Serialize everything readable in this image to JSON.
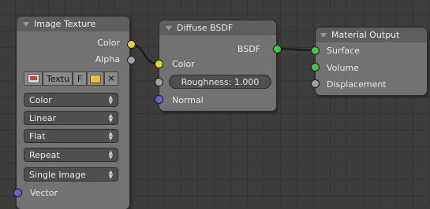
{
  "nodes": {
    "image_texture": {
      "title": "Image Texture",
      "outputs": [
        "Color",
        "Alpha"
      ],
      "image_field": {
        "name": "Textu",
        "fake_user": "F"
      },
      "color_space": "Color",
      "interpolation": "Linear",
      "projection": "Flat",
      "extension": "Repeat",
      "source": "Single Image",
      "input": "Vector"
    },
    "diffuse_bsdf": {
      "title": "Diffuse BSDF",
      "output": "BSDF",
      "inputs": {
        "color": "Color",
        "roughness": "Roughness: 1.000",
        "normal": "Normal"
      }
    },
    "material_output": {
      "title": "Material Output",
      "inputs": [
        "Surface",
        "Volume",
        "Displacement"
      ]
    }
  },
  "colors": {
    "color_socket": "#e4d03a",
    "shader_socket": "#42c746",
    "value_socket": "#a0a0a0",
    "vector_socket": "#6366d4",
    "link": "#1c1c1c"
  }
}
